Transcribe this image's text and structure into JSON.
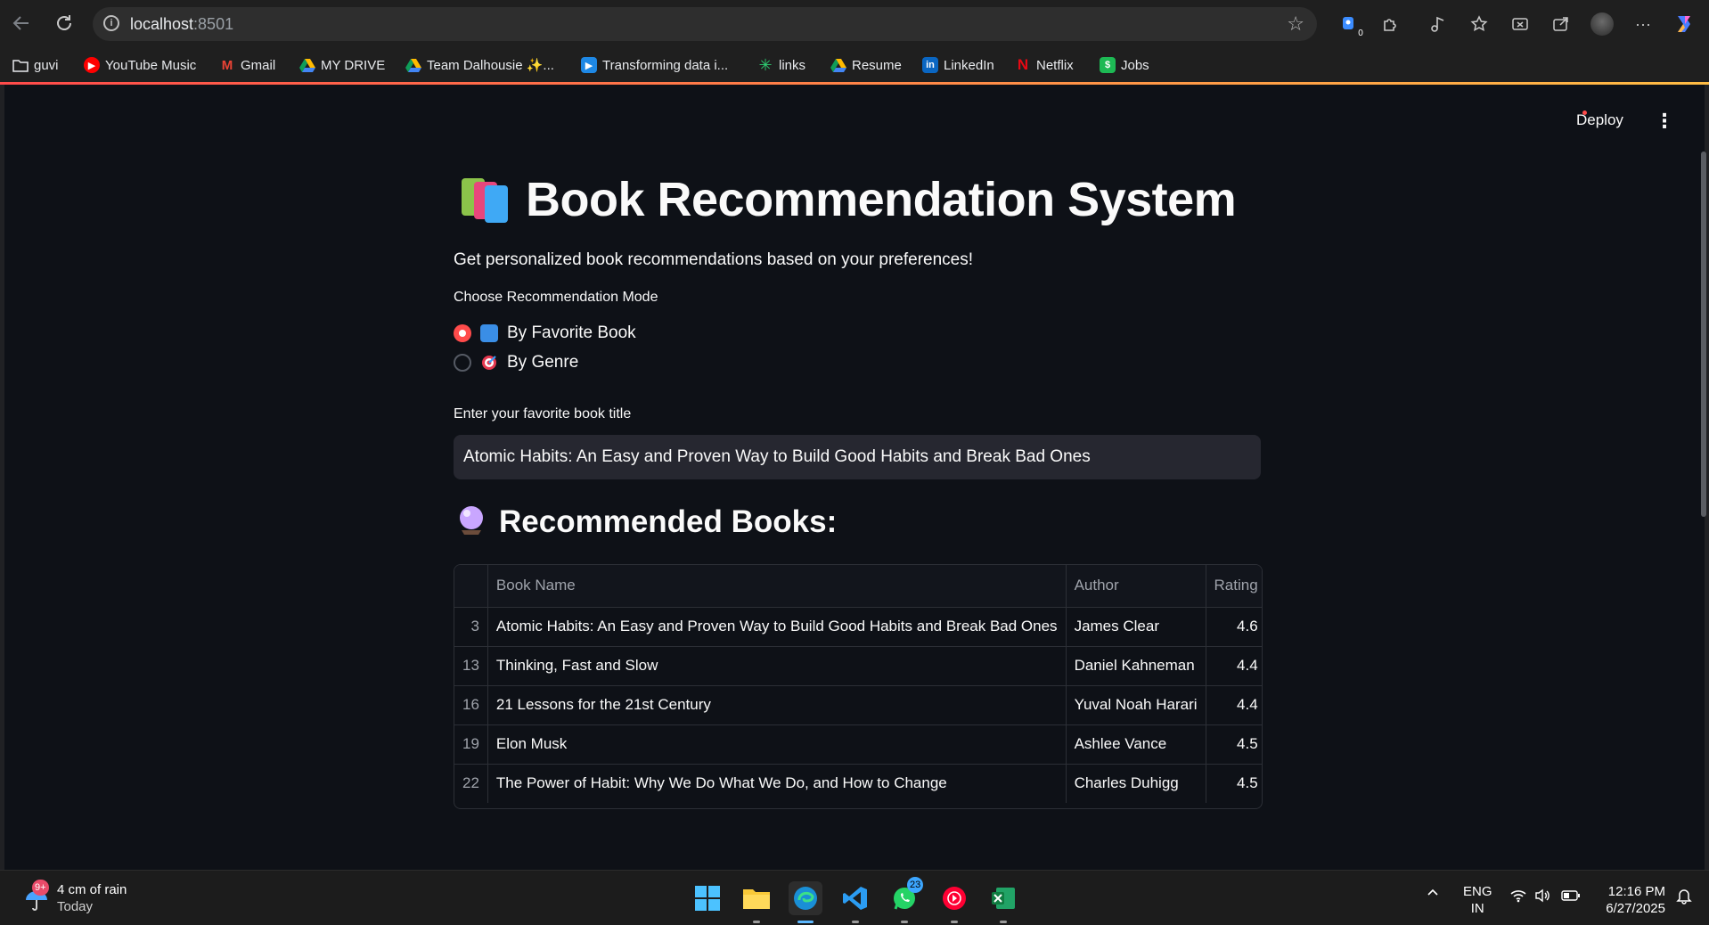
{
  "browser": {
    "url_host": "localhost",
    "url_port": ":8501",
    "bookmarks": [
      {
        "label": "guvi",
        "icon": "folder-icon"
      },
      {
        "label": "YouTube Music",
        "icon": "youtube-music-icon",
        "color": "#ff0000"
      },
      {
        "label": "Gmail",
        "icon": "gmail-icon",
        "color": "#ea4335"
      },
      {
        "label": "MY DRIVE",
        "icon": "google-drive-icon"
      },
      {
        "label": "Team Dalhousie ✨...",
        "icon": "google-drive-icon"
      },
      {
        "label": "Transforming data i...",
        "icon": "video-icon",
        "color": "#1e88e5"
      },
      {
        "label": "links",
        "icon": "asterisk-icon",
        "color": "#2ecc71"
      },
      {
        "label": "Resume",
        "icon": "google-drive-icon"
      },
      {
        "label": "LinkedIn",
        "icon": "linkedin-icon",
        "color": "#0a66c2"
      },
      {
        "label": "Netflix",
        "icon": "netflix-icon",
        "color": "#e50914"
      },
      {
        "label": "Jobs",
        "icon": "jobs-icon",
        "color": "#1db954"
      }
    ],
    "extension_badge": "0"
  },
  "app": {
    "deploy_label": "Deploy",
    "title": "Book Recommendation System",
    "subtitle": "Get personalized book recommendations based on your preferences!",
    "mode_label": "Choose Recommendation Mode",
    "modes": [
      {
        "label": "By Favorite Book",
        "selected": true,
        "icon": "blue-book-icon"
      },
      {
        "label": "By Genre",
        "selected": false,
        "icon": "dart-target-icon"
      }
    ],
    "input_label": "Enter your favorite book title",
    "input_value": "Atomic Habits: An Easy and Proven Way to Build Good Habits and Break Bad Ones",
    "recommend_heading": "Recommended Books:",
    "table": {
      "columns": [
        "",
        "Book Name",
        "Author",
        "Rating"
      ],
      "rows": [
        {
          "idx": "3",
          "name": "Atomic Habits: An Easy and Proven Way to Build Good Habits and Break Bad Ones",
          "author": "James Clear",
          "rating": "4.6"
        },
        {
          "idx": "13",
          "name": "Thinking, Fast and Slow",
          "author": "Daniel Kahneman",
          "rating": "4.4"
        },
        {
          "idx": "16",
          "name": "21 Lessons for the 21st Century",
          "author": "Yuval Noah Harari",
          "rating": "4.4"
        },
        {
          "idx": "19",
          "name": "Elon Musk",
          "author": "Ashlee Vance",
          "rating": "4.5"
        },
        {
          "idx": "22",
          "name": "The Power of Habit: Why We Do What We Do, and How to Change",
          "author": "Charles Duhigg",
          "rating": "4.5"
        }
      ]
    },
    "accent_color": "#ff4b4b"
  },
  "taskbar": {
    "weather_text": "4 cm of rain",
    "weather_sub": "Today",
    "weather_badge": "9+",
    "whatsapp_badge": "23",
    "lang_top": "ENG",
    "lang_bottom": "IN",
    "time": "12:16 PM",
    "date": "6/27/2025"
  }
}
